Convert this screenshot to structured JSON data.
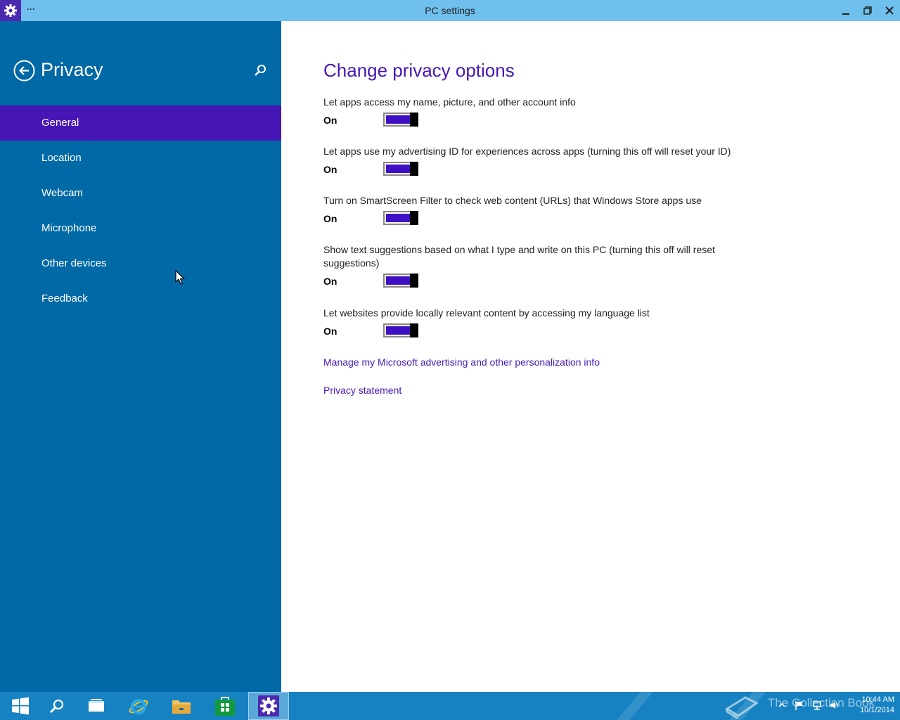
{
  "window": {
    "title": "PC settings",
    "more_label": "···",
    "app_icon": "gear-icon",
    "controls": [
      "minimize-icon",
      "restore-icon",
      "close-icon"
    ]
  },
  "sidebar": {
    "heading": "Privacy",
    "back_icon": "back-arrow-icon",
    "search_icon": "search-icon",
    "items": [
      {
        "label": "General",
        "active": true
      },
      {
        "label": "Location",
        "active": false
      },
      {
        "label": "Webcam",
        "active": false
      },
      {
        "label": "Microphone",
        "active": false
      },
      {
        "label": "Other devices",
        "active": false
      },
      {
        "label": "Feedback",
        "active": false
      }
    ]
  },
  "main": {
    "title": "Change privacy options",
    "settings": [
      {
        "label": "Let apps access my name, picture, and other account info",
        "state": "On"
      },
      {
        "label": "Let apps use my advertising ID for experiences across apps (turning this off will reset your ID)",
        "state": "On"
      },
      {
        "label": "Turn on SmartScreen Filter to check web content (URLs) that Windows Store apps use",
        "state": "On"
      },
      {
        "label": "Show text suggestions based on what I type and write on this PC (turning this off will reset suggestions)",
        "state": "On"
      },
      {
        "label": "Let websites provide locally relevant content by accessing my language list",
        "state": "On"
      }
    ],
    "links": [
      {
        "label": "Manage my Microsoft advertising and other personalization info"
      },
      {
        "label": "Privacy statement"
      }
    ]
  },
  "taskbar": {
    "buttons": [
      "start-icon",
      "search-icon",
      "task-view-icon",
      "internet-explorer-icon",
      "file-explorer-icon",
      "store-icon",
      "settings-icon"
    ],
    "watermark": "The Collection Book",
    "time": "10:44 AM",
    "date": "10/1/2014"
  },
  "colors": {
    "titlebar": "#6fc0ec",
    "sidebar": "#0069a6",
    "accent": "#4617b4",
    "toggle_on": "#3f0fc4",
    "taskbar": "#1782c2"
  }
}
